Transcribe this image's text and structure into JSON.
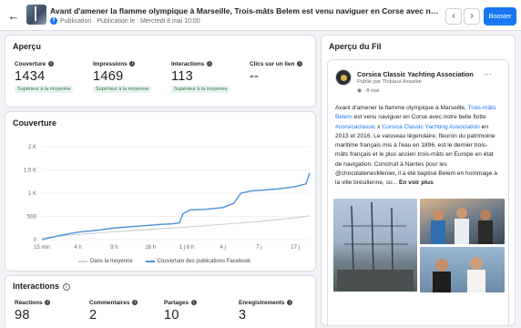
{
  "header": {
    "title": "Avant d'amener la flamme olympique à Marseille, Trois-mâts Belem est venu naviguer en Corse avec notre belle flotte #c...",
    "subtitle": "Publication · Publication le : Mercredi 8 mai 10:00",
    "boost_label": "Booster",
    "prev_glyph": "‹",
    "next_glyph": "›",
    "back_glyph": "←",
    "platform_glyph": "f"
  },
  "apercu": {
    "title": "Aperçu",
    "metrics": [
      {
        "label": "Couverture",
        "value": "1434",
        "badge": "Supérieur à la moyenne"
      },
      {
        "label": "Impressions",
        "value": "1469",
        "badge": "Supérieur à la moyenne"
      },
      {
        "label": "Interactions",
        "value": "113",
        "badge": "Supérieur à la moyenne"
      },
      {
        "label": "Clics sur un lien",
        "value": "--",
        "badge": ""
      }
    ]
  },
  "couverture": {
    "title": "Couverture",
    "legend_avg": "Dans la moyenne",
    "legend_cov": "Couverture des publications Facebook"
  },
  "chart_data": {
    "type": "line",
    "categories": [
      "15 min",
      "4 h",
      "9 h",
      "16 h",
      "1 j 6 h",
      "4 j",
      "7 j",
      "17 j"
    ],
    "yticks": [
      "0",
      "500",
      "1 K",
      "1,5 K",
      "2 K"
    ],
    "ylim": [
      0,
      2000
    ],
    "grid": true,
    "legend": "bottom",
    "series": [
      {
        "name": "Dans la moyenne",
        "color": "#cfd3d8",
        "x": [
          0,
          1,
          2,
          3,
          4,
          5,
          6,
          7,
          7.4
        ],
        "values": [
          40,
          110,
          170,
          220,
          270,
          330,
          390,
          470,
          510
        ]
      },
      {
        "name": "Couverture des publications Facebook",
        "color": "#4a90d9",
        "x": [
          0,
          0.5,
          1,
          1.5,
          2,
          2.5,
          3,
          3.3,
          3.6,
          3.8,
          3.9,
          4.1,
          4.5,
          5,
          5.3,
          5.5,
          5.8,
          6,
          6.5,
          7,
          7.3,
          7.4
        ],
        "values": [
          0,
          90,
          160,
          200,
          250,
          280,
          310,
          330,
          340,
          360,
          560,
          640,
          650,
          690,
          780,
          1000,
          1050,
          1060,
          1090,
          1140,
          1200,
          1434
        ]
      }
    ]
  },
  "interactions": {
    "title": "Interactions",
    "metrics": [
      {
        "label": "Réactions",
        "value": "98"
      },
      {
        "label": "Commentaires",
        "value": "2"
      },
      {
        "label": "Partages",
        "value": "10"
      },
      {
        "label": "Enregistrements",
        "value": "3"
      }
    ]
  },
  "preview": {
    "title": "Aperçu du Fil",
    "page_name": "Corsica Classic Yachting Association",
    "published_by": "Publié par Thibaud Assante",
    "date": "8 mai",
    "text_1": "Avant d'amener la flamme olympique à Marseille, ",
    "link_1": "Trois-mâts Belem",
    "text_2": " est venu naviguer en Corse avec notre belle flotte ",
    "link_2": "#corsicaclassic",
    "text_3": " x ",
    "link_3": "Corsica Classic Yachting Association",
    "text_4": " en 2013 et 2016. Le vaisseau légendaire, fleuron du patrimoine maritime français mis à l'eau en 1896, est le dernier trois-mâts français et le plus ancien trois-mâts en Europe en état de navigation. Construit à Nantes pour les @chocolateriesMenier, il a été baptisé Belem en hommage à la ville brésilienne, so... ",
    "see_more": "En voir plus",
    "more_glyph": "···"
  }
}
